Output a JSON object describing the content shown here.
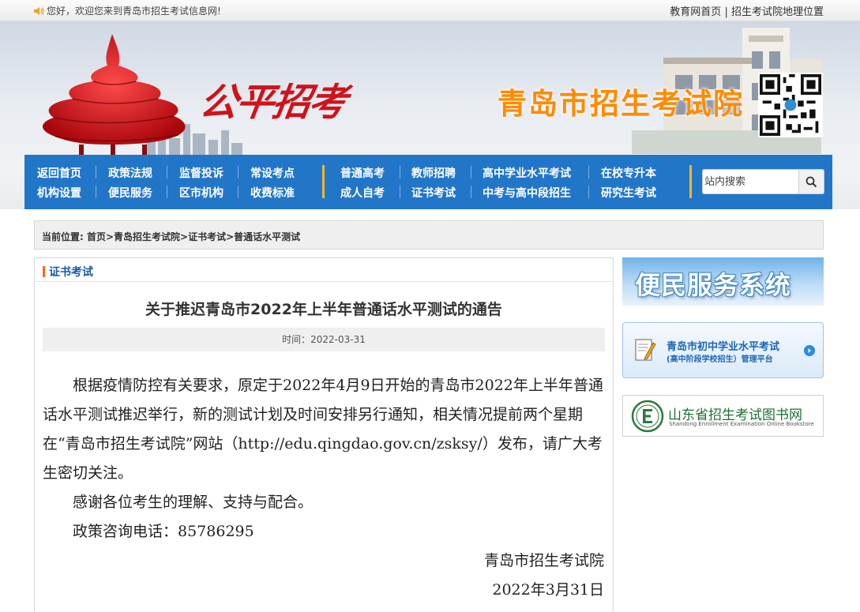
{
  "topbar": {
    "welcome": "您好，欢迎您来到青岛市招生考试信息网!",
    "links": [
      "教育网首页",
      "招生考试院地理位置"
    ],
    "separator": "|"
  },
  "banner": {
    "slogan": "公平招考",
    "site_title": "青岛市招生考试院"
  },
  "nav": {
    "group1_row1": [
      "返回首页",
      "政策法规",
      "监督投诉",
      "常设考点"
    ],
    "group1_row2": [
      "机构设置",
      "便民服务",
      "区市机构",
      "收费标准"
    ],
    "group2_row1": [
      "普通高考",
      "教师招聘",
      "高中学业水平考试",
      "在校专升本"
    ],
    "group2_row2": [
      "成人自考",
      "证书考试",
      "中考与高中段招生",
      "研究生考试"
    ],
    "search_placeholder": "站内搜索"
  },
  "breadcrumb": {
    "prefix": "当前位置:",
    "path": "首页>青岛招生考试院>证书考试>普通话水平测试"
  },
  "main": {
    "section": "证书考试",
    "title": "关于推迟青岛市2022年上半年普通话水平测试的通告",
    "meta": "时间：2022-03-31",
    "paragraphs": [
      "根据疫情防控有关要求，原定于2022年4月9日开始的青岛市2022年上半年普通话水平测试推迟举行，新的测试计划及时间安排另行通知，相关情况提前两个星期在“青岛市招生考试院”网站（http://edu.qingdao.gov.cn/zsksy/）发布，请广大考生密切关注。",
      "感谢各位考生的理解、支持与配合。",
      "政策咨询电话：85786295"
    ],
    "signature": "青岛市招生考试院",
    "date": "2022年3月31日"
  },
  "sidebar": {
    "service_banner": "便民服务系统",
    "platform_line1": "青岛市初中学业水平考试",
    "platform_line2": "(高中阶段学校招生）管理平台",
    "bookstore_cn": "山东省招生考试图书网",
    "bookstore_en": "Shandong Enrollment Examination Online Bookstore"
  },
  "colors": {
    "nav_bg": "#2276c8",
    "accent_orange": "#ff8a00",
    "slogan_red": "#d0121b",
    "section_blue": "#1a5aa6",
    "nav_divider": "#f3b827"
  }
}
